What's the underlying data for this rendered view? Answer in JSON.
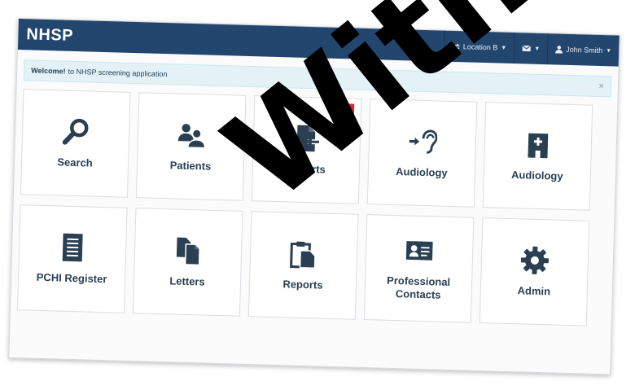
{
  "app": {
    "brand": "NHSP"
  },
  "navbar": {
    "location_label": "Location B",
    "user_label": "John Smith"
  },
  "alert": {
    "strong": "Welcome!",
    "text": "to NHSP screening application",
    "close": "×"
  },
  "tiles": [
    {
      "label": "Search",
      "icon": "search-icon"
    },
    {
      "label": "Patients",
      "icon": "users-icon"
    },
    {
      "label": "Imports",
      "icon": "import-icon",
      "badge": "3"
    },
    {
      "label": "Audiology",
      "icon": "ear-icon"
    },
    {
      "label": "Audiology",
      "icon": "hospital-icon"
    },
    {
      "label": "PCHI Register",
      "icon": "register-icon"
    },
    {
      "label": "Letters",
      "icon": "documents-icon"
    },
    {
      "label": "Reports",
      "icon": "clipboard-icon"
    },
    {
      "label": "Professional Contacts",
      "icon": "contact-card-icon"
    },
    {
      "label": "Admin",
      "icon": "gear-icon"
    }
  ],
  "watermark": {
    "text": "Withdrawn"
  },
  "colors": {
    "navbar": "#23466e",
    "badge": "#e22128",
    "alert_bg": "#e4f2f8",
    "icon": "#2a3f52"
  }
}
